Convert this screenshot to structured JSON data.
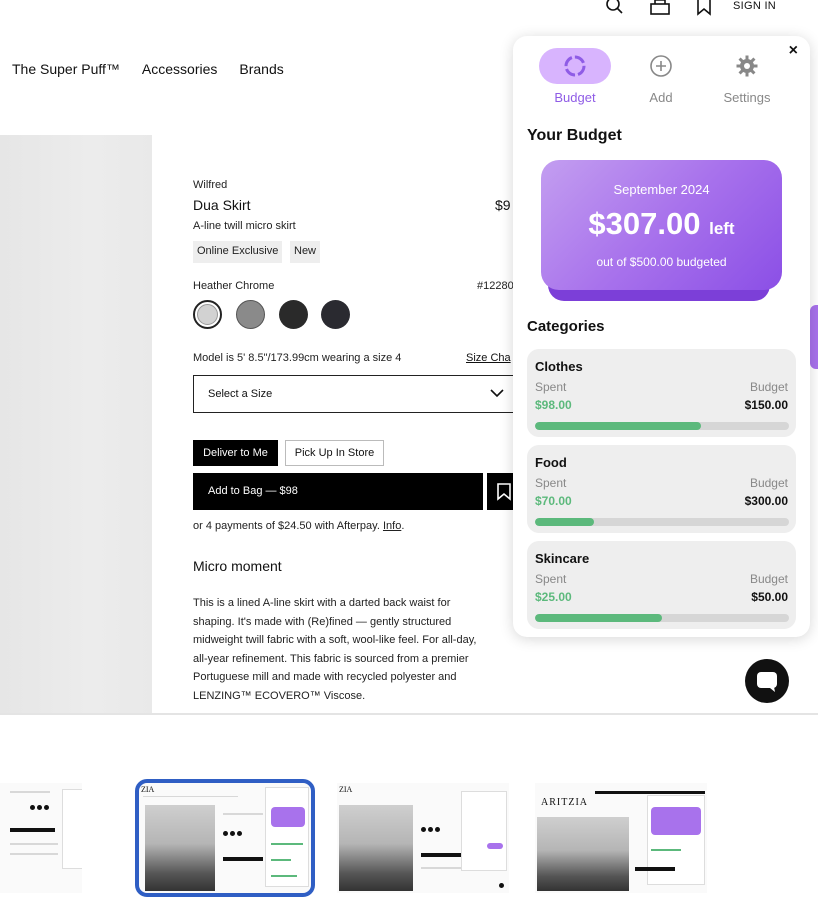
{
  "header": {
    "signin_label": "SIGN IN",
    "icons": [
      "search-icon",
      "bag-icon",
      "bookmark-icon"
    ]
  },
  "nav": {
    "items": [
      "The Super Puff™",
      "Accessories",
      "Brands"
    ]
  },
  "product": {
    "brand": "Wilfred",
    "name": "Dua Skirt",
    "price": "$9",
    "description": "A-line twill micro skirt",
    "tags": [
      "Online Exclusive",
      "New"
    ],
    "color_name": "Heather Chrome",
    "sku": "#12280",
    "swatch_colors": [
      "#d2d2d2",
      "#8a8a8a",
      "#2a2a2a",
      "#2a2a30"
    ],
    "model_info": "Model is 5' 8.5\"/173.99cm wearing a size 4",
    "size_chart_label": "Size Cha",
    "size_select_placeholder": "Select a Size",
    "deliver_label": "Deliver to Me",
    "pickup_label": "Pick Up In Store",
    "add_to_bag_label": "Add to Bag — $98",
    "afterpay_text": "or 4 payments of $24.50 with Afterpay. ",
    "afterpay_link": "Info",
    "afterpay_period": ".",
    "section_title": "Micro moment",
    "details_lines": [
      "This is a lined A-line skirt with a darted back waist for",
      "shaping. It's made with (Re)fined — gently structured",
      "midweight twill fabric with a soft, wool-like feel. For all-day,",
      "all-year refinement. This fabric is sourced from a premier",
      "Portuguese mill and made with recycled polyester and",
      "LENZING™ ECOVERO™ Viscose."
    ]
  },
  "budget_popup": {
    "close_label": "×",
    "tabs": [
      {
        "label": "Budget",
        "icon": "budget-ring-icon",
        "active": true
      },
      {
        "label": "Add",
        "icon": "plus-circle-icon",
        "active": false
      },
      {
        "label": "Settings",
        "icon": "gear-icon",
        "active": false
      }
    ],
    "title": "Your Budget",
    "card": {
      "month": "September 2024",
      "amount_left": "$307.00",
      "left_label": "left",
      "subtitle": "out of $500.00 budgeted"
    },
    "categories_title": "Categories",
    "categories": [
      {
        "name": "Clothes",
        "spent_label": "Spent",
        "budget_label": "Budget",
        "spent": "$98.00",
        "budget": "$150.00",
        "progress": 0.653
      },
      {
        "name": "Food",
        "spent_label": "Spent",
        "budget_label": "Budget",
        "spent": "$70.00",
        "budget": "$300.00",
        "progress": 0.233
      },
      {
        "name": "Skincare",
        "spent_label": "Spent",
        "budget_label": "Budget",
        "spent": "$25.00",
        "budget": "$50.00",
        "progress": 0.5
      }
    ],
    "accent_color": "#a872ec",
    "spent_color": "#5cb97c"
  },
  "thumbnails": {
    "count": 4,
    "selected_index": 1,
    "labels": [
      "",
      "ZIA",
      "ZIA",
      "ARITZIA"
    ]
  }
}
